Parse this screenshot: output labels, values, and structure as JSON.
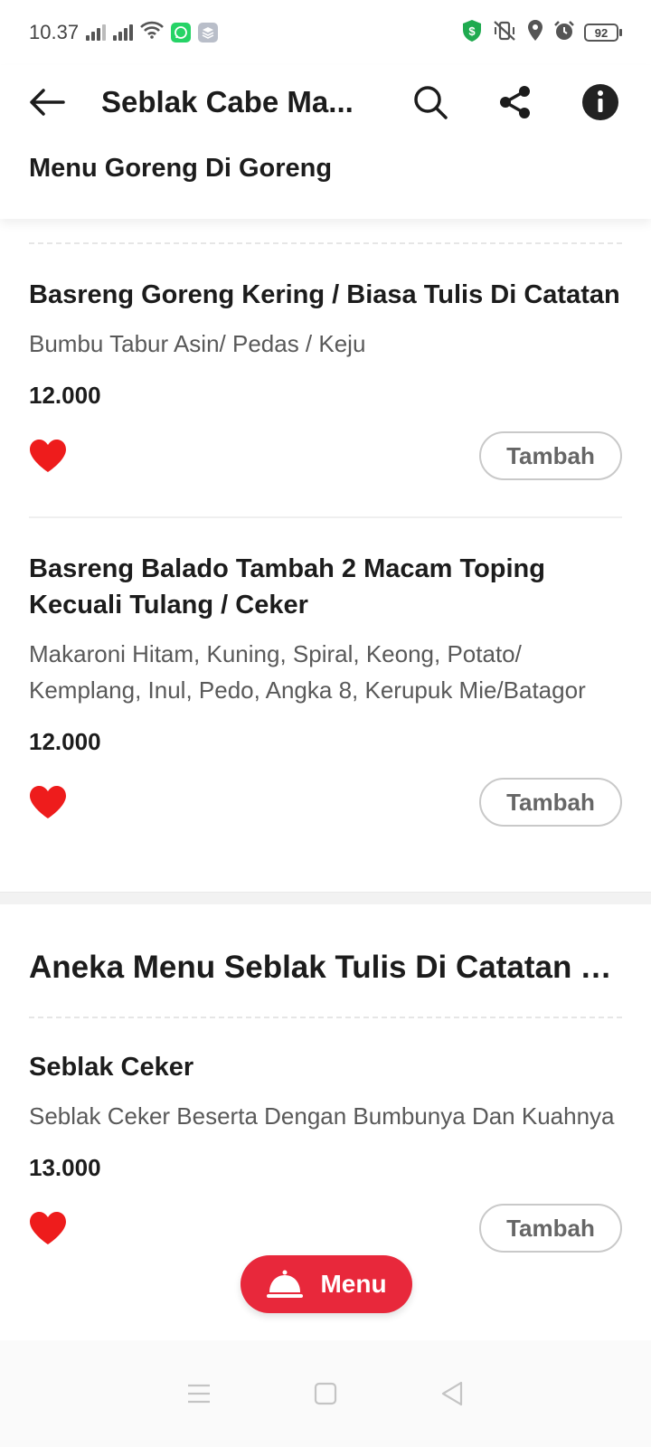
{
  "status_bar": {
    "time": "10.37",
    "battery": "92"
  },
  "header": {
    "title": "Seblak Cabe Ma...",
    "section_tab": "Menu Goreng Di Goreng"
  },
  "colors": {
    "accent": "#e8283b",
    "heart": "#ee1c1c",
    "whatsapp": "#25d366",
    "shield": "#1faa4f"
  },
  "items_group1": [
    {
      "title": "Basreng Goreng Kering / Biasa Tulis Di Catatan",
      "description": "Bumbu Tabur Asin/ Pedas / Keju",
      "price": "12.000",
      "add_label": "Tambah"
    },
    {
      "title": "Basreng Balado Tambah 2 Macam Toping Kecuali Tulang / Ceker",
      "description": "Makaroni Hitam, Kuning, Spiral, Keong, Potato/ Kemplang, Inul, Pedo, Angka 8, Kerupuk Mie/Batagor",
      "price": "12.000",
      "add_label": "Tambah"
    }
  ],
  "section2": {
    "title": "Aneka Menu Seblak Tulis Di Catatan Y...",
    "items": [
      {
        "title": "Seblak Ceker",
        "description": "Seblak Ceker Beserta Dengan Bumbunya Dan Kuahnya",
        "price": "13.000",
        "add_label": "Tambah"
      }
    ]
  },
  "fab": {
    "label": "Menu"
  },
  "icons": {
    "back": "arrow-left",
    "search": "magnifier",
    "share": "share-nodes",
    "info": "info-circle",
    "favorite": "heart",
    "menu": "cloche"
  }
}
